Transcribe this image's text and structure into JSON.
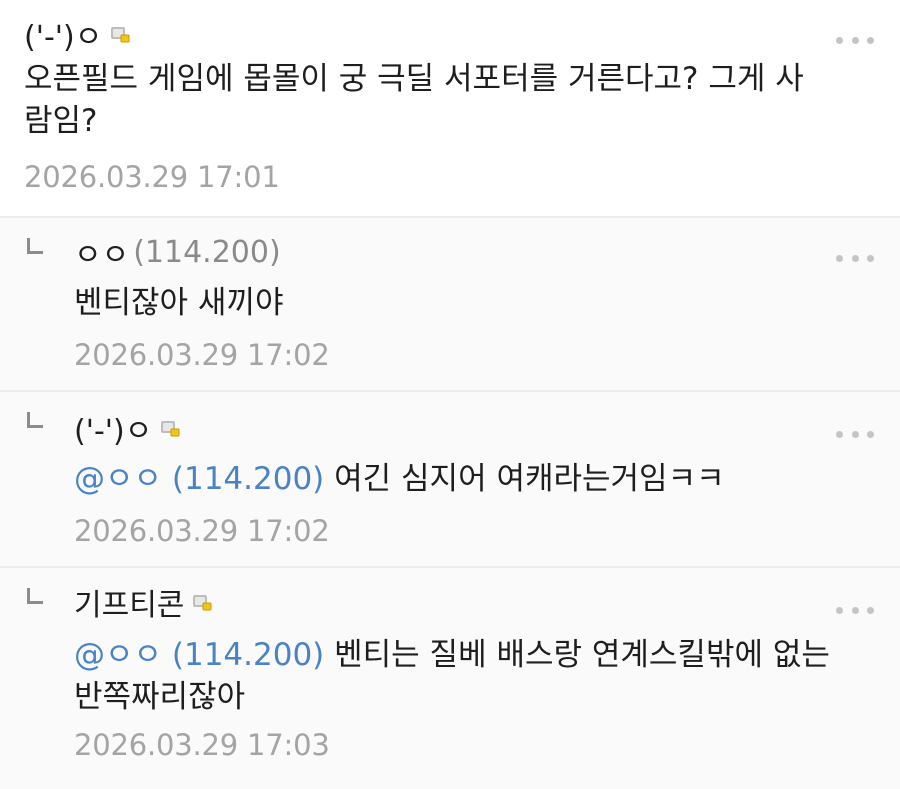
{
  "comments": [
    {
      "nick": "('-')ㅇ",
      "ip": "",
      "badge": "member-badge-icon",
      "mention": "",
      "text": "오픈필드 게임에 몹몰이 궁 극딜 서포터를 거른다고? 그게 사람임?",
      "date": "2026.03.29 17:01"
    },
    {
      "nick": "ㅇㅇ",
      "ip": "(114.200)",
      "badge": "",
      "mention": "",
      "text": "벤티잖아 새끼야",
      "date": "2026.03.29 17:02"
    },
    {
      "nick": "('-')ㅇ",
      "ip": "",
      "badge": "member-badge-icon",
      "mention": "@ㅇㅇ (114.200)",
      "text": "여긴 심지어 여캐라는거임ㅋㅋ",
      "date": "2026.03.29 17:02"
    },
    {
      "nick": "기프티콘",
      "ip": "",
      "badge": "member-badge-icon",
      "mention": "@ㅇㅇ (114.200)",
      "text": "벤티는 질베 배스랑 연계스킬밖에 없는 반쪽짜리잖아",
      "date": "2026.03.29 17:03"
    }
  ],
  "colors": {
    "mention": "#4a83c4",
    "date": "#a4a4a4",
    "ip": "#8a8a8a",
    "separator": "#ececec"
  }
}
